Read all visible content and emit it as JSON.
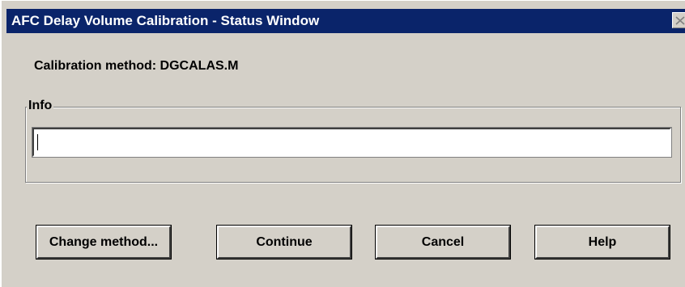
{
  "window": {
    "title": "AFC Delay Volume Calibration - Status Window"
  },
  "method": {
    "label": "Calibration method: DGCALAS.M"
  },
  "info_group": {
    "legend": "Info",
    "value": ""
  },
  "buttons": {
    "change_method": "Change method...",
    "continue": "Continue",
    "cancel": "Cancel",
    "help": "Help"
  },
  "colors": {
    "titlebar": "#0a246a",
    "face": "#d4d0c8"
  },
  "icons": {
    "close": "close-icon"
  }
}
